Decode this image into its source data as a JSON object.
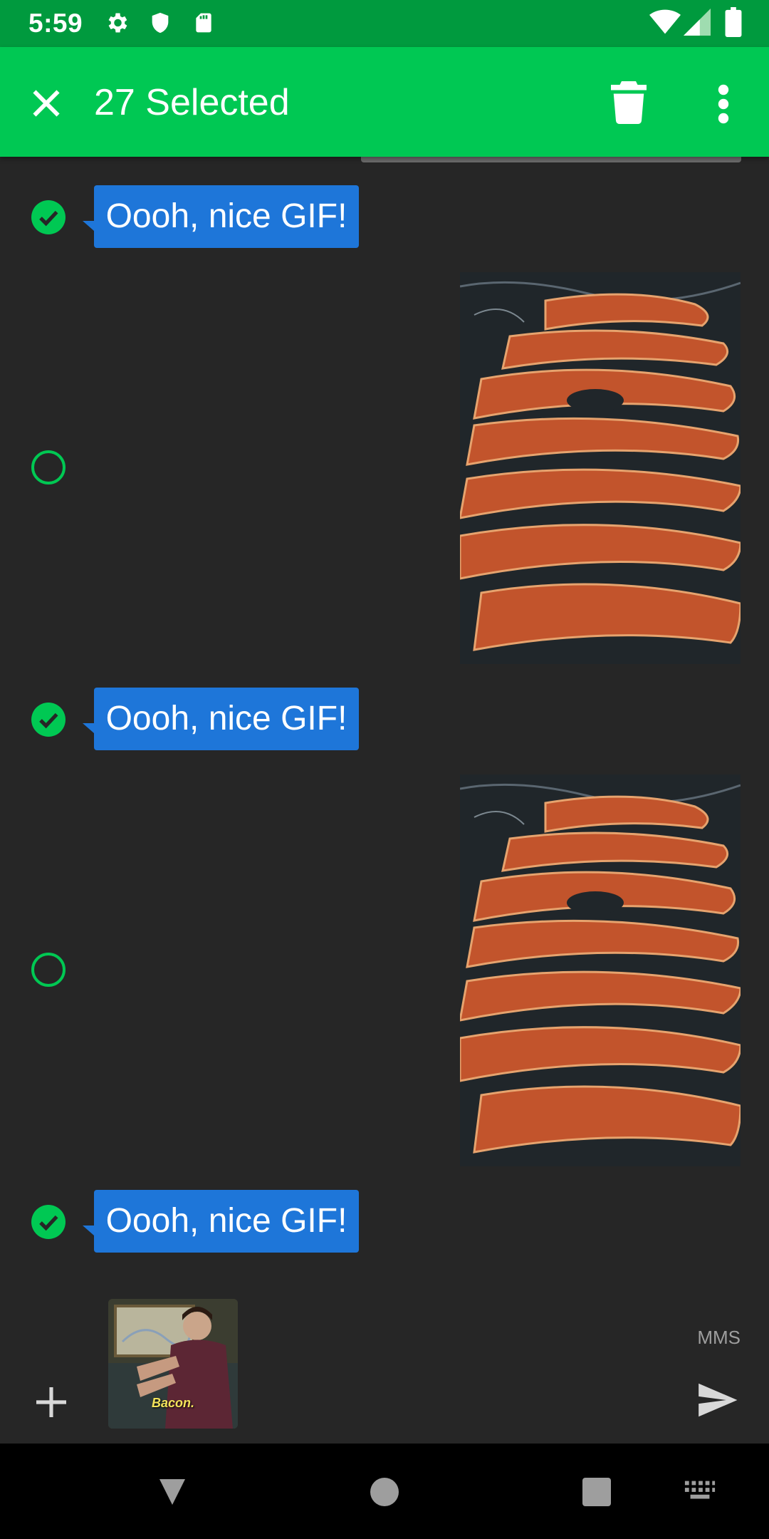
{
  "status_bar": {
    "time": "5:59",
    "left_icons": [
      "gear-icon",
      "shield-icon",
      "sd-card-icon"
    ],
    "right_icons": [
      "wifi-icon",
      "signal-icon",
      "battery-icon"
    ]
  },
  "action_bar": {
    "title": "27 Selected",
    "close_icon": "close-icon",
    "delete_icon": "trash-icon",
    "more_icon": "more-vert-icon"
  },
  "messages": [
    {
      "type": "text",
      "text": "Oooh, nice GIF!",
      "selected": true
    },
    {
      "type": "gif",
      "selected": false
    },
    {
      "type": "text",
      "text": "Oooh, nice GIF!",
      "selected": true
    },
    {
      "type": "gif",
      "selected": false
    },
    {
      "type": "text",
      "text": "Oooh, nice GIF!",
      "selected": true
    }
  ],
  "composer": {
    "attachment_caption": "Bacon.",
    "mode_label": "MMS",
    "add_icon": "plus-icon",
    "send_icon": "send-icon"
  },
  "nav_bar": {
    "icons": [
      "back-icon",
      "home-icon",
      "recents-icon",
      "keyboard-icon"
    ]
  },
  "colors": {
    "status_bar": "#009a3e",
    "action_bar": "#00c853",
    "bubble": "#1e76d9",
    "background": "#262626"
  }
}
